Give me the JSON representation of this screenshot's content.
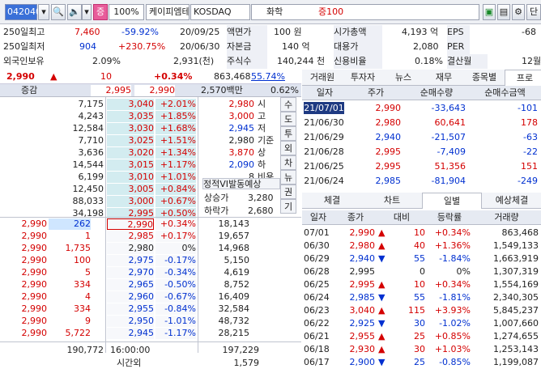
{
  "toolbar": {
    "code": "042040",
    "badge": "증",
    "pct": "100%",
    "stock_name": "케이피엠테크",
    "market": "KOSDAQ",
    "sector": "화학",
    "margin": "증100"
  },
  "info": {
    "r1": [
      "250일최고",
      "7,460",
      "-59.92%",
      "20/09/25",
      "액면가",
      "100 원",
      "시가총액",
      "4,193 억",
      "EPS",
      "-68"
    ],
    "r2": [
      "250일최저",
      "904",
      "+230.75%",
      "20/06/30",
      "자본금",
      "140 억",
      "대용가",
      "2,080",
      "PER",
      ""
    ],
    "r3": [
      "외국인보유",
      "2.09%",
      "2,931(천)",
      "주식수",
      "140,244 천",
      "신용비율",
      "0.18%",
      "결산월",
      "12월"
    ]
  },
  "price": {
    "cur": "2,990",
    "arrow": "▲",
    "chg": "10",
    "rate": "+0.34%",
    "vol": "863,468",
    "volrate": "55.74%",
    "vs_label": "증감",
    "vs_ask": "2,995",
    "vs_bid": "2,990",
    "amt": "2,570백만",
    "amt_rate": "0.62%"
  },
  "asks": [
    {
      "q": "7,175",
      "p": "3,040",
      "r": "+2.01%"
    },
    {
      "q": "4,243",
      "p": "3,035",
      "r": "+1.85%"
    },
    {
      "q": "12,584",
      "p": "3,030",
      "r": "+1.68%"
    },
    {
      "q": "7,710",
      "p": "3,025",
      "r": "+1.51%"
    },
    {
      "q": "3,636",
      "p": "3,020",
      "r": "+1.34%"
    },
    {
      "q": "14,544",
      "p": "3,015",
      "r": "+1.17%"
    },
    {
      "q": "6,199",
      "p": "3,010",
      "r": "+1.01%"
    },
    {
      "q": "12,450",
      "p": "3,005",
      "r": "+0.84%"
    },
    {
      "q": "88,033",
      "p": "3,000",
      "r": "+0.67%"
    },
    {
      "q": "34,198",
      "p": "2,995",
      "r": "+0.50%"
    }
  ],
  "bids": [
    {
      "t": "2,990",
      "tq": "262",
      "p": "2,990",
      "r": "+0.34%",
      "q": "18,143"
    },
    {
      "t": "2,990",
      "tq": "1",
      "p": "2,985",
      "r": "+0.17%",
      "q": "19,657"
    },
    {
      "t": "2,990",
      "tq": "1,735",
      "p": "2,980",
      "r": "0%",
      "q": "14,968"
    },
    {
      "t": "2,990",
      "tq": "100",
      "p": "2,975",
      "r": "-0.17%",
      "q": "5,150"
    },
    {
      "t": "2,990",
      "tq": "5",
      "p": "2,970",
      "r": "-0.34%",
      "q": "4,619"
    },
    {
      "t": "2,990",
      "tq": "334",
      "p": "2,965",
      "r": "-0.50%",
      "q": "8,752"
    },
    {
      "t": "2,990",
      "tq": "4",
      "p": "2,960",
      "r": "-0.67%",
      "q": "16,409"
    },
    {
      "t": "2,990",
      "tq": "334",
      "p": "2,955",
      "r": "-0.84%",
      "q": "32,584"
    },
    {
      "t": "2,990",
      "tq": "9",
      "p": "2,950",
      "r": "-1.01%",
      "q": "48,732"
    },
    {
      "t": "2,990",
      "tq": "5,722",
      "p": "2,945",
      "r": "-1.17%",
      "q": "28,215"
    }
  ],
  "summary": {
    "ask_total": "190,772",
    "time": "16:00:00",
    "bid_total": "197,229",
    "after_label": "시간외",
    "after_val": "1,579"
  },
  "ohlc": [
    [
      "2,980",
      "시"
    ],
    [
      "3,000",
      "고"
    ],
    [
      "2,945",
      "저"
    ],
    [
      "2,980",
      "기준"
    ],
    [
      "3,870",
      "상"
    ],
    [
      "2,090",
      "하"
    ],
    [
      "8",
      "비용"
    ]
  ],
  "side_tabs": [
    "수",
    "도",
    "투",
    "외",
    "차",
    "뉴",
    "권",
    "기"
  ],
  "expect": {
    "title": "정적VI발동예상",
    "up_label": "상승가",
    "up": "3,280",
    "dn_label": "하락가",
    "dn": "2,680"
  },
  "top_tabs": [
    "거래원",
    "투자자",
    "뉴스",
    "재무",
    "종목별",
    "프로"
  ],
  "t1": {
    "headers": [
      "일자",
      "주가",
      "순매수량",
      "순매수금액"
    ],
    "rows": [
      [
        "21/07/01",
        "2,990",
        "-33,643",
        "-101"
      ],
      [
        "21/06/30",
        "2,980",
        "60,641",
        "178"
      ],
      [
        "21/06/29",
        "2,940",
        "-21,507",
        "-63"
      ],
      [
        "21/06/28",
        "2,995",
        "-7,409",
        "-22"
      ],
      [
        "21/06/25",
        "2,995",
        "51,356",
        "151"
      ],
      [
        "21/06/24",
        "2,985",
        "-81,904",
        "-249"
      ]
    ]
  },
  "mid_tabs": [
    "체결",
    "차트",
    "일별",
    "예상체결"
  ],
  "t2": {
    "headers": [
      "일자",
      "종가",
      "대비",
      "등락률",
      "거래량"
    ],
    "rows": [
      [
        "07/01",
        "2,990",
        "▲",
        "10",
        "+0.34%",
        "863,468"
      ],
      [
        "06/30",
        "2,980",
        "▲",
        "40",
        "+1.36%",
        "1,549,133"
      ],
      [
        "06/29",
        "2,940",
        "▼",
        "55",
        "-1.84%",
        "1,663,919"
      ],
      [
        "06/28",
        "2,995",
        "",
        "0",
        "0%",
        "1,307,319"
      ],
      [
        "06/25",
        "2,995",
        "▲",
        "10",
        "+0.34%",
        "1,554,169"
      ],
      [
        "06/24",
        "2,985",
        "▼",
        "55",
        "-1.81%",
        "2,340,305"
      ],
      [
        "06/23",
        "3,040",
        "▲",
        "115",
        "+3.93%",
        "5,845,237"
      ],
      [
        "06/22",
        "2,925",
        "▼",
        "30",
        "-1.02%",
        "1,007,660"
      ],
      [
        "06/21",
        "2,955",
        "▲",
        "25",
        "+0.85%",
        "1,274,655"
      ],
      [
        "06/18",
        "2,930",
        "▲",
        "30",
        "+1.03%",
        "1,253,143"
      ],
      [
        "06/17",
        "2,900",
        "▼",
        "25",
        "-0.85%",
        "1,199,087"
      ]
    ]
  }
}
